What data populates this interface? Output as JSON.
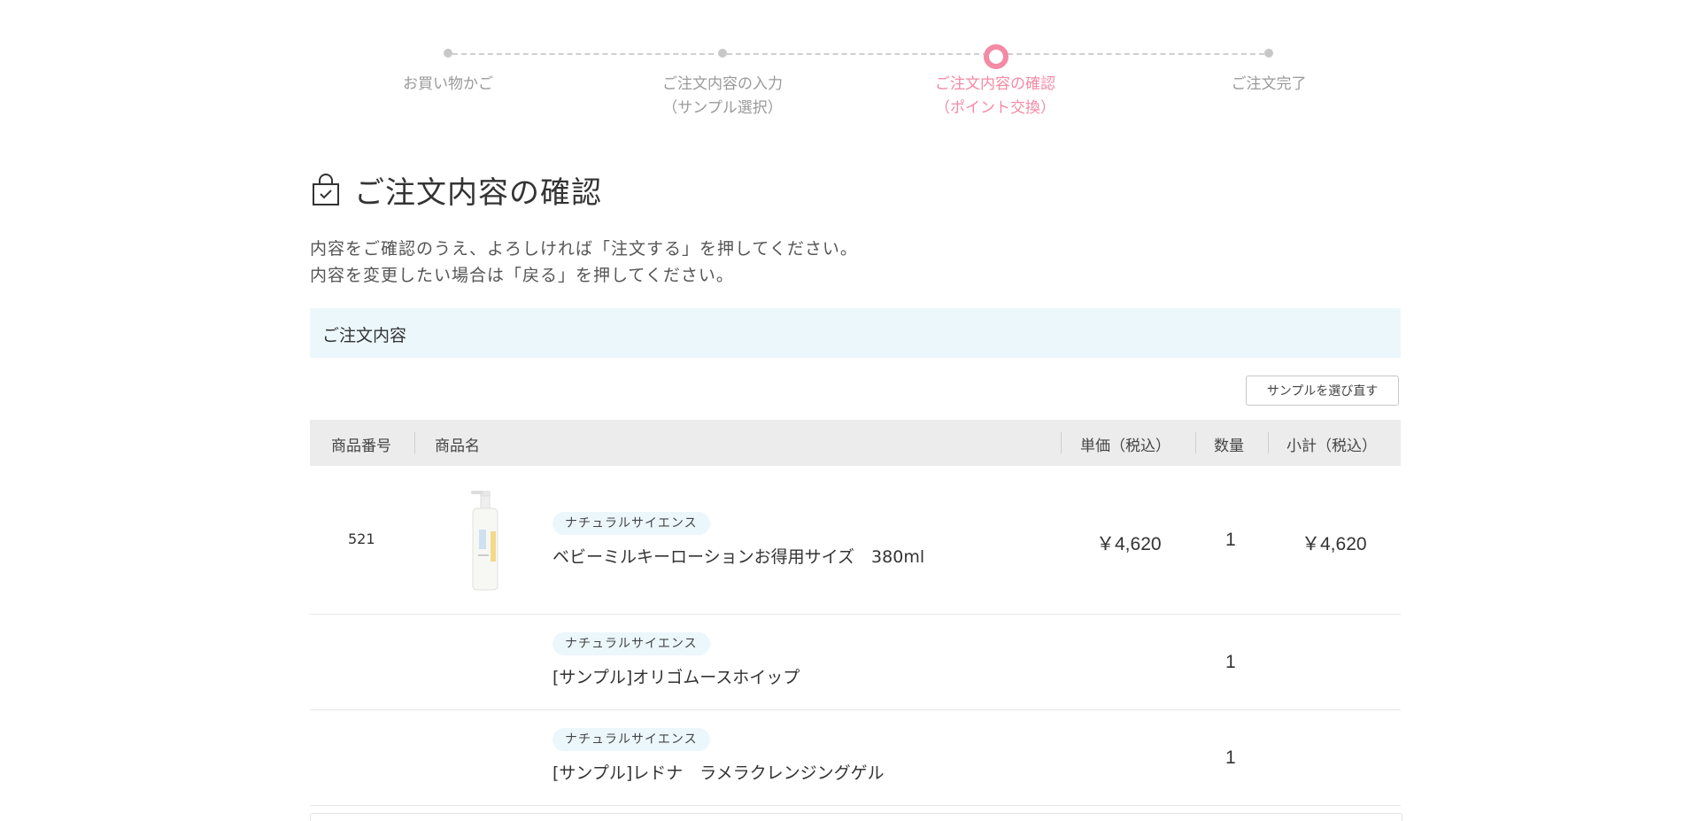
{
  "stepper": {
    "steps": [
      {
        "line1": "お買い物かご",
        "line2": ""
      },
      {
        "line1": "ご注文内容の入力",
        "line2": "（サンプル選択）"
      },
      {
        "line1": "ご注文内容の確認",
        "line2": "（ポイント交換）"
      },
      {
        "line1": "ご注文完了",
        "line2": ""
      }
    ],
    "active_color": "#f48aa4"
  },
  "page": {
    "title": "ご注文内容の確認",
    "desc_line1": "内容をご確認のうえ、よろしければ「注文する」を押してください。",
    "desc_line2": "内容を変更したい場合は「戻る」を押してください。",
    "section_title": "ご注文内容",
    "reselect_label": "サンプルを選び直す"
  },
  "table": {
    "headers": {
      "item_no": "商品番号",
      "item_name": "商品名",
      "unit_price": "単価（税込）",
      "qty": "数量",
      "subtotal": "小計（税込）"
    },
    "rows": [
      {
        "item_no": "521",
        "brand": "ナチュラルサイエンス",
        "name": "ベビーミルキーローションお得用サイズ　380ml",
        "unit_price": "￥4,620",
        "qty": "1",
        "subtotal": "￥4,620"
      },
      {
        "item_no": "",
        "brand": "ナチュラルサイエンス",
        "name": "[サンプル]オリゴムースホイップ",
        "unit_price": "",
        "qty": "1",
        "subtotal": ""
      },
      {
        "item_no": "",
        "brand": "ナチュラルサイエンス",
        "name": "[サンプル]レドナ　ラメラクレンジングゲル",
        "unit_price": "",
        "qty": "1",
        "subtotal": ""
      }
    ]
  },
  "icons": {
    "title_icon": "shopping-bag-check-icon",
    "product_image": "lotion-pump-bottle-image"
  }
}
